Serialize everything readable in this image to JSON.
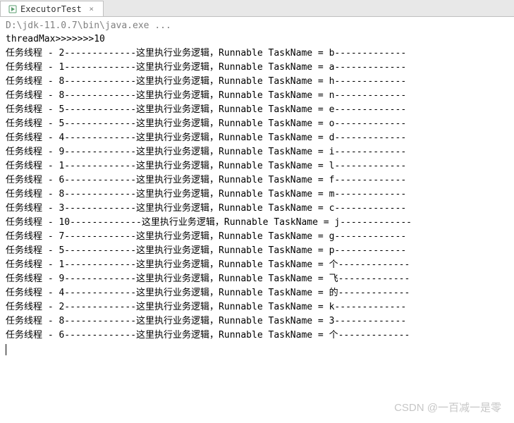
{
  "tab": {
    "title": "ExecutorTest",
    "close_symbol": "×"
  },
  "command": "D:\\jdk-11.0.7\\bin\\java.exe ...",
  "header_line": "threadMax>>>>>>>10",
  "thread_prefix": "任务线程",
  "logic_text": "这里执行业务逻辑",
  "taskname_label": "Runnable TaskName",
  "lines": [
    {
      "thread": "2",
      "task": "b"
    },
    {
      "thread": "1",
      "task": "a"
    },
    {
      "thread": "8",
      "task": "h"
    },
    {
      "thread": "8",
      "task": "n"
    },
    {
      "thread": "5",
      "task": "e"
    },
    {
      "thread": "5",
      "task": "o"
    },
    {
      "thread": "4",
      "task": "d"
    },
    {
      "thread": "9",
      "task": "i"
    },
    {
      "thread": "1",
      "task": "l"
    },
    {
      "thread": "6",
      "task": "f"
    },
    {
      "thread": "8",
      "task": "m"
    },
    {
      "thread": "3",
      "task": "c"
    },
    {
      "thread": "10",
      "task": "j"
    },
    {
      "thread": "7",
      "task": "g"
    },
    {
      "thread": "5",
      "task": "p"
    },
    {
      "thread": "1",
      "task": "个"
    },
    {
      "thread": "9",
      "task": "飞"
    },
    {
      "thread": "4",
      "task": "的"
    },
    {
      "thread": "2",
      "task": "k"
    },
    {
      "thread": "8",
      "task": "3"
    },
    {
      "thread": "6",
      "task": "个"
    }
  ],
  "watermark": "CSDN @一百减一是零"
}
